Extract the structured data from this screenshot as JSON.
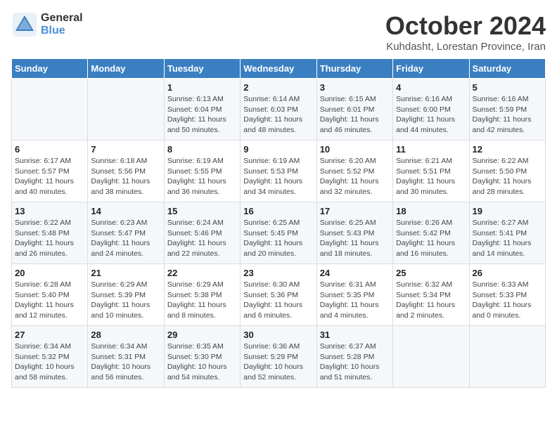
{
  "header": {
    "logo_general": "General",
    "logo_blue": "Blue",
    "month": "October 2024",
    "location": "Kuhdasht, Lorestan Province, Iran"
  },
  "weekdays": [
    "Sunday",
    "Monday",
    "Tuesday",
    "Wednesday",
    "Thursday",
    "Friday",
    "Saturday"
  ],
  "weeks": [
    [
      {
        "day": "",
        "info": ""
      },
      {
        "day": "",
        "info": ""
      },
      {
        "day": "1",
        "info": "Sunrise: 6:13 AM\nSunset: 6:04 PM\nDaylight: 11 hours and 50 minutes."
      },
      {
        "day": "2",
        "info": "Sunrise: 6:14 AM\nSunset: 6:03 PM\nDaylight: 11 hours and 48 minutes."
      },
      {
        "day": "3",
        "info": "Sunrise: 6:15 AM\nSunset: 6:01 PM\nDaylight: 11 hours and 46 minutes."
      },
      {
        "day": "4",
        "info": "Sunrise: 6:16 AM\nSunset: 6:00 PM\nDaylight: 11 hours and 44 minutes."
      },
      {
        "day": "5",
        "info": "Sunrise: 6:16 AM\nSunset: 5:59 PM\nDaylight: 11 hours and 42 minutes."
      }
    ],
    [
      {
        "day": "6",
        "info": "Sunrise: 6:17 AM\nSunset: 5:57 PM\nDaylight: 11 hours and 40 minutes."
      },
      {
        "day": "7",
        "info": "Sunrise: 6:18 AM\nSunset: 5:56 PM\nDaylight: 11 hours and 38 minutes."
      },
      {
        "day": "8",
        "info": "Sunrise: 6:19 AM\nSunset: 5:55 PM\nDaylight: 11 hours and 36 minutes."
      },
      {
        "day": "9",
        "info": "Sunrise: 6:19 AM\nSunset: 5:53 PM\nDaylight: 11 hours and 34 minutes."
      },
      {
        "day": "10",
        "info": "Sunrise: 6:20 AM\nSunset: 5:52 PM\nDaylight: 11 hours and 32 minutes."
      },
      {
        "day": "11",
        "info": "Sunrise: 6:21 AM\nSunset: 5:51 PM\nDaylight: 11 hours and 30 minutes."
      },
      {
        "day": "12",
        "info": "Sunrise: 6:22 AM\nSunset: 5:50 PM\nDaylight: 11 hours and 28 minutes."
      }
    ],
    [
      {
        "day": "13",
        "info": "Sunrise: 6:22 AM\nSunset: 5:48 PM\nDaylight: 11 hours and 26 minutes."
      },
      {
        "day": "14",
        "info": "Sunrise: 6:23 AM\nSunset: 5:47 PM\nDaylight: 11 hours and 24 minutes."
      },
      {
        "day": "15",
        "info": "Sunrise: 6:24 AM\nSunset: 5:46 PM\nDaylight: 11 hours and 22 minutes."
      },
      {
        "day": "16",
        "info": "Sunrise: 6:25 AM\nSunset: 5:45 PM\nDaylight: 11 hours and 20 minutes."
      },
      {
        "day": "17",
        "info": "Sunrise: 6:25 AM\nSunset: 5:43 PM\nDaylight: 11 hours and 18 minutes."
      },
      {
        "day": "18",
        "info": "Sunrise: 6:26 AM\nSunset: 5:42 PM\nDaylight: 11 hours and 16 minutes."
      },
      {
        "day": "19",
        "info": "Sunrise: 6:27 AM\nSunset: 5:41 PM\nDaylight: 11 hours and 14 minutes."
      }
    ],
    [
      {
        "day": "20",
        "info": "Sunrise: 6:28 AM\nSunset: 5:40 PM\nDaylight: 11 hours and 12 minutes."
      },
      {
        "day": "21",
        "info": "Sunrise: 6:29 AM\nSunset: 5:39 PM\nDaylight: 11 hours and 10 minutes."
      },
      {
        "day": "22",
        "info": "Sunrise: 6:29 AM\nSunset: 5:38 PM\nDaylight: 11 hours and 8 minutes."
      },
      {
        "day": "23",
        "info": "Sunrise: 6:30 AM\nSunset: 5:36 PM\nDaylight: 11 hours and 6 minutes."
      },
      {
        "day": "24",
        "info": "Sunrise: 6:31 AM\nSunset: 5:35 PM\nDaylight: 11 hours and 4 minutes."
      },
      {
        "day": "25",
        "info": "Sunrise: 6:32 AM\nSunset: 5:34 PM\nDaylight: 11 hours and 2 minutes."
      },
      {
        "day": "26",
        "info": "Sunrise: 6:33 AM\nSunset: 5:33 PM\nDaylight: 11 hours and 0 minutes."
      }
    ],
    [
      {
        "day": "27",
        "info": "Sunrise: 6:34 AM\nSunset: 5:32 PM\nDaylight: 10 hours and 58 minutes."
      },
      {
        "day": "28",
        "info": "Sunrise: 6:34 AM\nSunset: 5:31 PM\nDaylight: 10 hours and 56 minutes."
      },
      {
        "day": "29",
        "info": "Sunrise: 6:35 AM\nSunset: 5:30 PM\nDaylight: 10 hours and 54 minutes."
      },
      {
        "day": "30",
        "info": "Sunrise: 6:36 AM\nSunset: 5:29 PM\nDaylight: 10 hours and 52 minutes."
      },
      {
        "day": "31",
        "info": "Sunrise: 6:37 AM\nSunset: 5:28 PM\nDaylight: 10 hours and 51 minutes."
      },
      {
        "day": "",
        "info": ""
      },
      {
        "day": "",
        "info": ""
      }
    ]
  ]
}
